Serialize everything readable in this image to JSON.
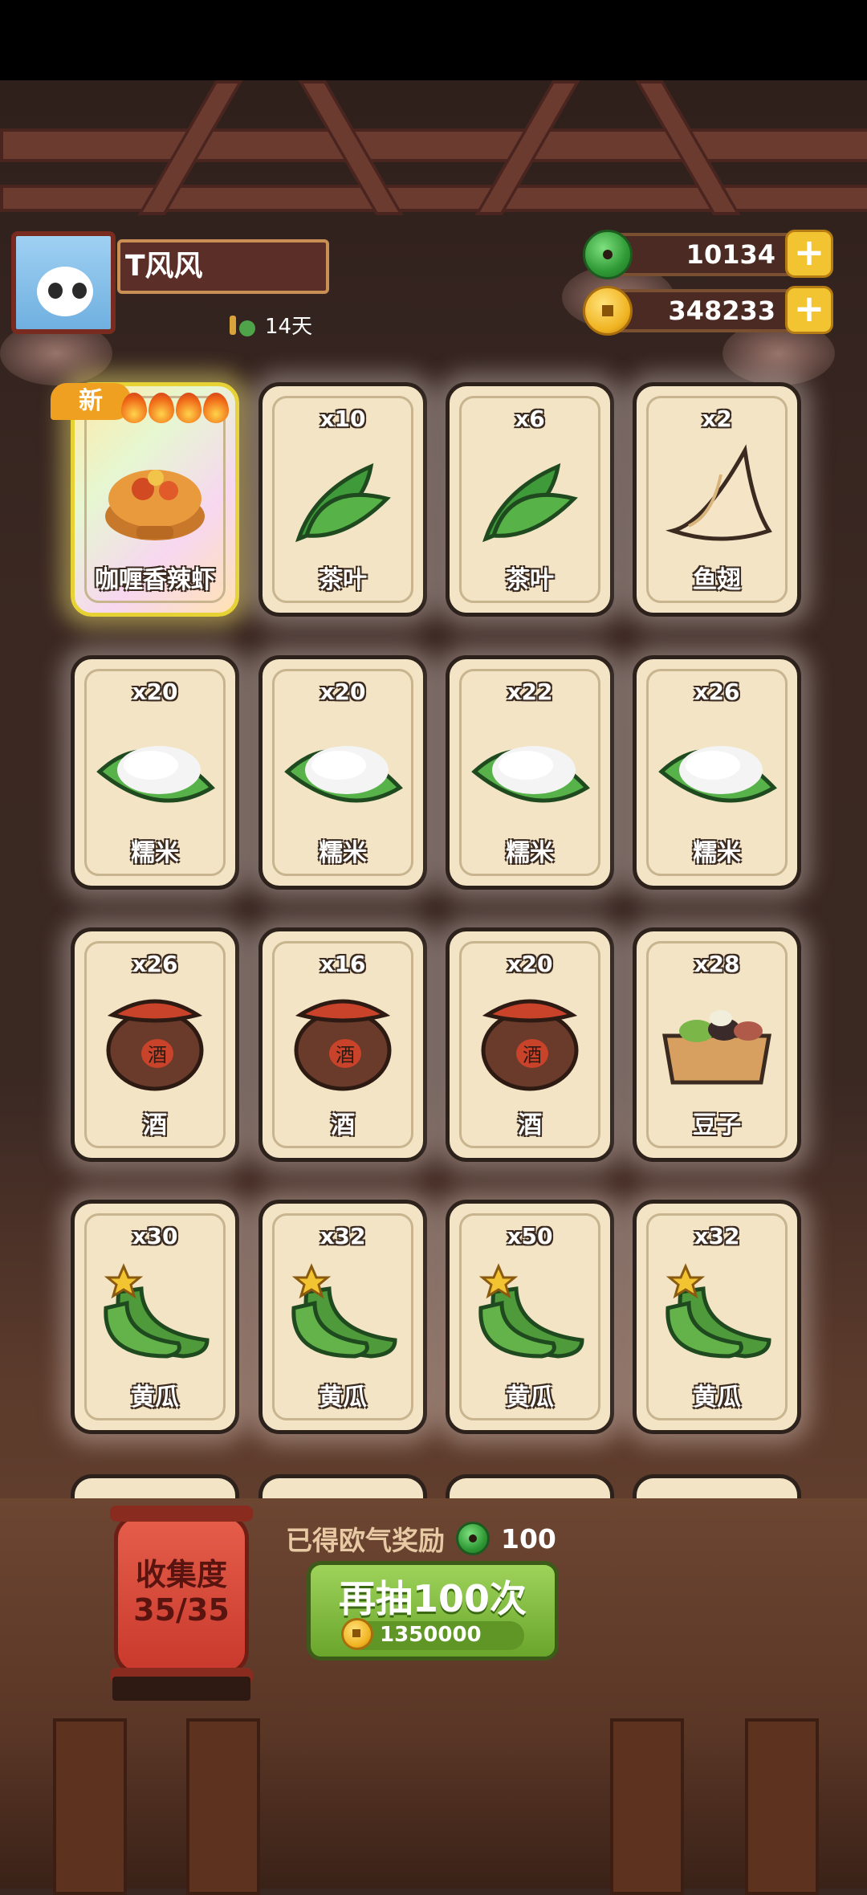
{
  "header": {
    "player_name": "T风风",
    "days": "14天",
    "jade_amount": "10134",
    "coin_amount": "348233",
    "add_icon": "plus-icon"
  },
  "cards": [
    {
      "count": "",
      "label": "咖喱香辣虾",
      "art": "curry-shrimp-dish",
      "is_new": true,
      "new_label": "新",
      "flames": 4
    },
    {
      "count": "x10",
      "label": "茶叶",
      "art": "tea-leaf"
    },
    {
      "count": "x6",
      "label": "茶叶",
      "art": "tea-leaf"
    },
    {
      "count": "x2",
      "label": "鱼翅",
      "art": "shark-fin"
    },
    {
      "count": "x20",
      "label": "糯米",
      "art": "glutinous-rice"
    },
    {
      "count": "x20",
      "label": "糯米",
      "art": "glutinous-rice"
    },
    {
      "count": "x22",
      "label": "糯米",
      "art": "glutinous-rice"
    },
    {
      "count": "x26",
      "label": "糯米",
      "art": "glutinous-rice"
    },
    {
      "count": "x26",
      "label": "酒",
      "art": "wine-jar",
      "jar_text": "酒"
    },
    {
      "count": "x16",
      "label": "酒",
      "art": "wine-jar",
      "jar_text": "酒"
    },
    {
      "count": "x20",
      "label": "酒",
      "art": "wine-jar",
      "jar_text": "酒"
    },
    {
      "count": "x28",
      "label": "豆子",
      "art": "beans-box"
    },
    {
      "count": "x30",
      "label": "黄瓜",
      "art": "cucumber"
    },
    {
      "count": "x32",
      "label": "黄瓜",
      "art": "cucumber"
    },
    {
      "count": "x50",
      "label": "黄瓜",
      "art": "cucumber"
    },
    {
      "count": "x32",
      "label": "黄瓜",
      "art": "cucumber"
    }
  ],
  "footer": {
    "collection_label": "收集度",
    "collection_value": "35/35",
    "reward_label": "已得欧气奖励",
    "reward_amount": "100",
    "draw_button_label": "再抽100次",
    "draw_cost": "1350000"
  },
  "colors": {
    "card_bg": "#f2e4c4",
    "card_border": "#2d211c",
    "draw_button": "#8cc443",
    "lantern": "#d94a3a",
    "plus_button": "#f3c432"
  }
}
